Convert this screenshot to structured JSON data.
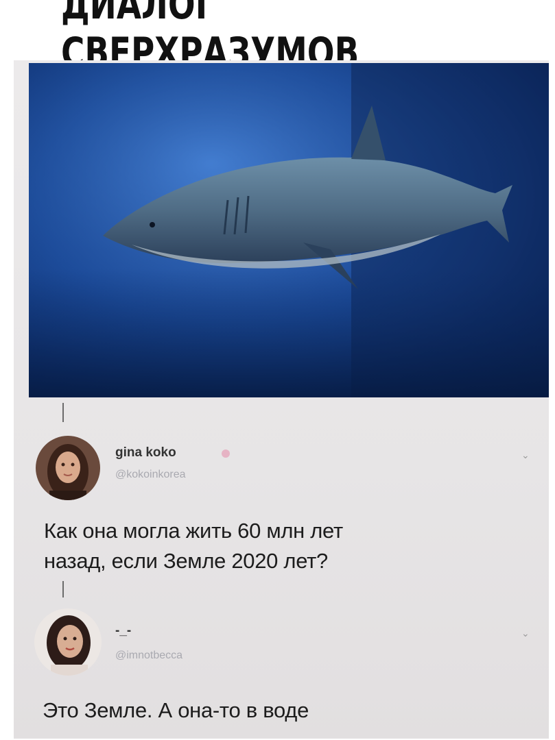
{
  "headline": "ДИАЛОГ СВЕРХРАЗУМОВ",
  "post1": {
    "name": "gina koko",
    "handle": "@kokoinkorea",
    "text_line1": "Как она могла жить 60 млн лет",
    "text_line2": "назад, если Земле 2020 лет?",
    "avatar_icon": "woman-portrait"
  },
  "post2": {
    "name": "-_-",
    "handle": "@imnotbecca",
    "text": "Это Земле. А она-то в воде",
    "avatar_icon": "woman-portrait"
  },
  "photo": {
    "subject": "shark-underwater-image"
  }
}
